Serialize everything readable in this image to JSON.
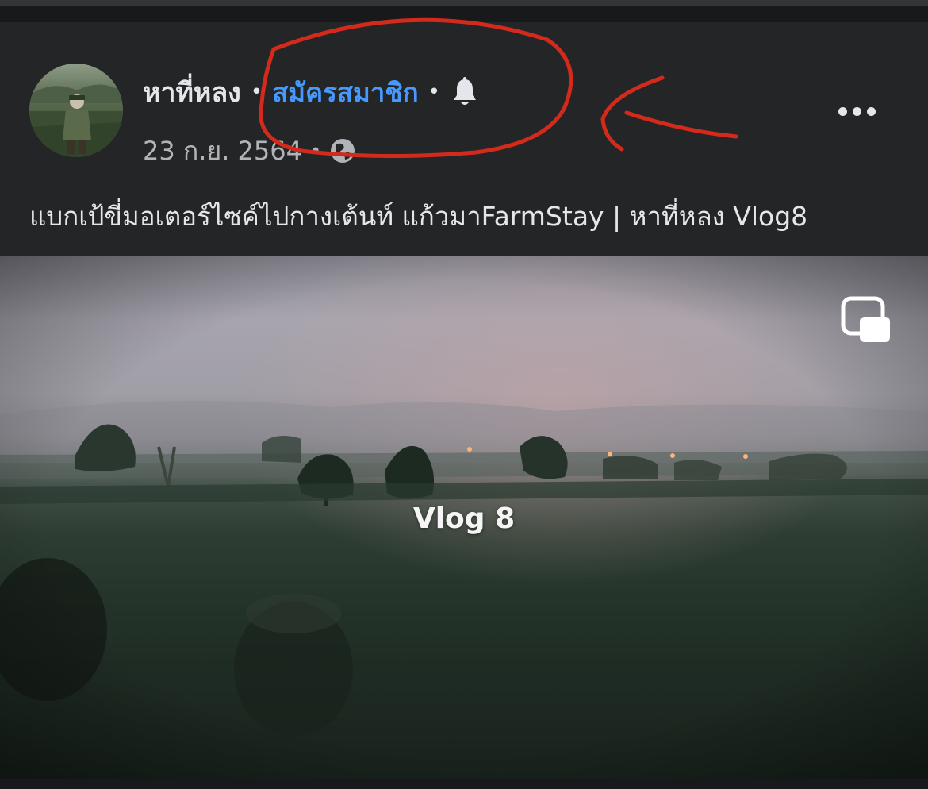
{
  "post": {
    "author": "หาที่หลง",
    "subscribe_label": "สมัครสมาชิก",
    "separator": "•",
    "date": "23 ก.ย. 2564",
    "privacy_icon": "globe-icon",
    "bell_icon": "bell-icon",
    "more_icon": "more-options-icon",
    "caption": "แบกเป้ขี่มอเตอร์ไซค์ไปกางเต้นท์ แก้วมาFarmStay | หาที่หลง Vlog8"
  },
  "video": {
    "title_overlay": "Vlog 8",
    "pip_icon": "picture-in-picture-icon"
  },
  "colors": {
    "background": "#18191a",
    "card": "#242526",
    "text_primary": "#e4e6eb",
    "text_secondary": "#b0b3b8",
    "accent_blue": "#4599ff",
    "annotation_red": "#d42a1c"
  }
}
